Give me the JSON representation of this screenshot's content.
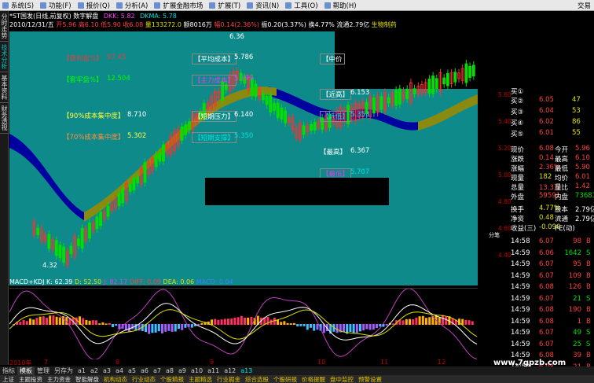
{
  "menu": {
    "items": [
      "系统(S)",
      "功能(F)",
      "报价(Q)",
      "分析(A)",
      "扩展金融市场",
      "扩展(T)",
      "资讯(N)",
      "工具(O)",
      "帮助(H)"
    ],
    "right": "交易"
  },
  "left_tabs": [
    "分时走势",
    "技术分析",
    "基本资料",
    "财务透视"
  ],
  "header": {
    "line1_title": "*ST国发(日线,前复权) 数字解盘",
    "line1_dkk": "DKK: 5.82",
    "line1_dkma": "DKMA: 5.78",
    "line2_date": "2010/12/31/五",
    "line2_open": "开5.96",
    "line2_high": "高6.10",
    "line2_low": "低5.90",
    "line2_close": "收6.08",
    "line2_vol": "量133272.0",
    "line2_amount": "额8016万",
    "line2_change": "幅0.14(2.36%)",
    "line2_amp": "振0.20(3.37%)",
    "line2_turn": "换4.77%",
    "line2_float": "流通2.79亿",
    "line2_sector": "生物制药"
  },
  "main_labels": {
    "profit_ratio_label": "【获利盘%】",
    "profit_ratio_value": "97.45",
    "trapped_label": "【套牢盘%】",
    "trapped_value": "12.504",
    "conc90_label": "【90%成本集中度】",
    "conc90_value": "8.710",
    "conc70_label": "【70%成本集中度】",
    "conc70_value": "5.302",
    "avgcost_label": "【平均成本】",
    "avgcost_value": "5.786",
    "maincost_label": "【主力成本】",
    "maincost_value": "5.399",
    "shortpress_label": "【短期压力】",
    "shortpress_value": "6.140",
    "shortsupport_label": "【短期支撑】",
    "shortsupport_value": "5.350",
    "mid_label": "【中价",
    "near_high_label": "【近高】",
    "near_high_value": "6.153",
    "near_low_label": "【近低】",
    "near_low_value": "5.353",
    "highest_label": "【最高】",
    "highest_value": "6.367",
    "lowest_label": "【最低】",
    "lowest_value": "5.707",
    "peak_label": "6.36",
    "trough_label": "4.32"
  },
  "indicator_header": {
    "name": "MACD+KDJ",
    "k": "K: 62.39",
    "d": "D: 52.50",
    "j": "J: 82.17",
    "diff": "DIFF: 0.09",
    "dea": "DEA: 0.06",
    "macd": "MACD: 0.04"
  },
  "indicator_scale": [
    "100.00",
    "50.00",
    "0.00"
  ],
  "x_axis": [
    "2010年",
    "7",
    "8",
    "9",
    "10",
    "11",
    "12"
  ],
  "y_axis": [
    "5.60",
    "5.40",
    "5.20",
    "5.00",
    "4.80",
    "4.60",
    "4.40"
  ],
  "quote": {
    "buy": [
      {
        "label": "买②",
        "price": "6.05",
        "vol": "47"
      },
      {
        "label": "买③",
        "price": "6.04",
        "vol": "53"
      },
      {
        "label": "买④",
        "price": "6.02",
        "vol": "86"
      },
      {
        "label": "买⑤",
        "price": "6.01",
        "vol": "55"
      }
    ],
    "first_label": "买①",
    "stats": [
      {
        "l1": "现价",
        "v1": "6.08",
        "l2": "今开",
        "v2": "5.96"
      },
      {
        "l1": "涨跌",
        "v1": "0.14",
        "l2": "最高",
        "v2": "6.10"
      },
      {
        "l1": "涨幅",
        "v1": "2.36%",
        "l2": "最低",
        "v2": "5.90"
      },
      {
        "l1": "现量",
        "v1": "182",
        "l2": "均价",
        "v2": "6.01"
      },
      {
        "l1": "总量",
        "v1": "13.3万",
        "l2": "量比",
        "v2": "1.42"
      },
      {
        "l1": "外盘",
        "v1": "59591",
        "l2": "内盘",
        "v2": "73681"
      }
    ],
    "stats2": [
      {
        "l1": "换手",
        "v1": "4.77%",
        "l2": "股本",
        "v2": "2.79亿"
      },
      {
        "l1": "净资",
        "v1": "0.48",
        "l2": "流通",
        "v2": "2.79亿"
      },
      {
        "l1": "收益(三)",
        "v1": "-0.090",
        "l2": "PE(动)",
        "v2": ""
      }
    ],
    "ticks": [
      {
        "t": "14:58",
        "p": "6.07",
        "v": "98",
        "f": "B"
      },
      {
        "t": "14:59",
        "p": "6.06",
        "v": "1642",
        "f": "S"
      },
      {
        "t": "14:59",
        "p": "6.07",
        "v": "95",
        "f": "B"
      },
      {
        "t": "14:59",
        "p": "6.07",
        "v": "109",
        "f": "B"
      },
      {
        "t": "14:59",
        "p": "6.08",
        "v": "126",
        "f": "B"
      },
      {
        "t": "14:59",
        "p": "6.07",
        "v": "21",
        "f": "S"
      },
      {
        "t": "14:59",
        "p": "6.08",
        "v": "190",
        "f": "B"
      },
      {
        "t": "14:59",
        "p": "6.08",
        "v": "1",
        "f": "B"
      },
      {
        "t": "14:59",
        "p": "6.07",
        "v": "49",
        "f": "S"
      },
      {
        "t": "14:59",
        "p": "6.07",
        "v": "25",
        "f": "S"
      },
      {
        "t": "14:59",
        "p": "6.08",
        "v": "39",
        "f": "B"
      },
      {
        "t": "14:59",
        "p": "6.08",
        "v": "21",
        "f": "B"
      },
      {
        "t": "15:00",
        "p": "6.08",
        "v": "182",
        "f": "B"
      }
    ],
    "tab": "分笔"
  },
  "bottom_tabs": [
    "指标",
    "模板",
    "管理",
    "另存为",
    "a1",
    "a2",
    "a3",
    "a4",
    "a5",
    "a6",
    "a7",
    "a8",
    "a9",
    "a10",
    "a11",
    "a12",
    "a13"
  ],
  "status": [
    "上证",
    "主题投资",
    "主力资金",
    "智能解盘",
    "机构动态",
    "行业动态",
    "个股精报",
    "主题精选",
    "行业掘金",
    "综合选股",
    "个股研报",
    "价格提醒",
    "盘中监控",
    "预警设置"
  ],
  "watermark": "www.7gpzb.com",
  "colors": {
    "bg_main": "#0e8a8a",
    "up": "#ff3030",
    "down": "#00e000",
    "blue_band": "#0000a0",
    "olive_band": "#8a8a10"
  }
}
